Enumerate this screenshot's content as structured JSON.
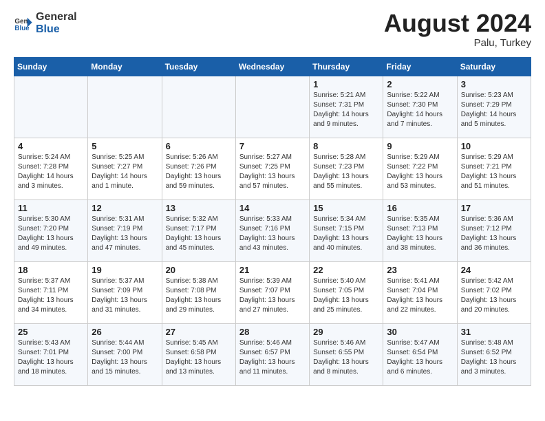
{
  "header": {
    "logo_general": "General",
    "logo_blue": "Blue",
    "month_year": "August 2024",
    "location": "Palu, Turkey"
  },
  "weekdays": [
    "Sunday",
    "Monday",
    "Tuesday",
    "Wednesday",
    "Thursday",
    "Friday",
    "Saturday"
  ],
  "weeks": [
    [
      {
        "day": "",
        "content": ""
      },
      {
        "day": "",
        "content": ""
      },
      {
        "day": "",
        "content": ""
      },
      {
        "day": "",
        "content": ""
      },
      {
        "day": "1",
        "content": "Sunrise: 5:21 AM\nSunset: 7:31 PM\nDaylight: 14 hours\nand 9 minutes."
      },
      {
        "day": "2",
        "content": "Sunrise: 5:22 AM\nSunset: 7:30 PM\nDaylight: 14 hours\nand 7 minutes."
      },
      {
        "day": "3",
        "content": "Sunrise: 5:23 AM\nSunset: 7:29 PM\nDaylight: 14 hours\nand 5 minutes."
      }
    ],
    [
      {
        "day": "4",
        "content": "Sunrise: 5:24 AM\nSunset: 7:28 PM\nDaylight: 14 hours\nand 3 minutes."
      },
      {
        "day": "5",
        "content": "Sunrise: 5:25 AM\nSunset: 7:27 PM\nDaylight: 14 hours\nand 1 minute."
      },
      {
        "day": "6",
        "content": "Sunrise: 5:26 AM\nSunset: 7:26 PM\nDaylight: 13 hours\nand 59 minutes."
      },
      {
        "day": "7",
        "content": "Sunrise: 5:27 AM\nSunset: 7:25 PM\nDaylight: 13 hours\nand 57 minutes."
      },
      {
        "day": "8",
        "content": "Sunrise: 5:28 AM\nSunset: 7:23 PM\nDaylight: 13 hours\nand 55 minutes."
      },
      {
        "day": "9",
        "content": "Sunrise: 5:29 AM\nSunset: 7:22 PM\nDaylight: 13 hours\nand 53 minutes."
      },
      {
        "day": "10",
        "content": "Sunrise: 5:29 AM\nSunset: 7:21 PM\nDaylight: 13 hours\nand 51 minutes."
      }
    ],
    [
      {
        "day": "11",
        "content": "Sunrise: 5:30 AM\nSunset: 7:20 PM\nDaylight: 13 hours\nand 49 minutes."
      },
      {
        "day": "12",
        "content": "Sunrise: 5:31 AM\nSunset: 7:19 PM\nDaylight: 13 hours\nand 47 minutes."
      },
      {
        "day": "13",
        "content": "Sunrise: 5:32 AM\nSunset: 7:17 PM\nDaylight: 13 hours\nand 45 minutes."
      },
      {
        "day": "14",
        "content": "Sunrise: 5:33 AM\nSunset: 7:16 PM\nDaylight: 13 hours\nand 43 minutes."
      },
      {
        "day": "15",
        "content": "Sunrise: 5:34 AM\nSunset: 7:15 PM\nDaylight: 13 hours\nand 40 minutes."
      },
      {
        "day": "16",
        "content": "Sunrise: 5:35 AM\nSunset: 7:13 PM\nDaylight: 13 hours\nand 38 minutes."
      },
      {
        "day": "17",
        "content": "Sunrise: 5:36 AM\nSunset: 7:12 PM\nDaylight: 13 hours\nand 36 minutes."
      }
    ],
    [
      {
        "day": "18",
        "content": "Sunrise: 5:37 AM\nSunset: 7:11 PM\nDaylight: 13 hours\nand 34 minutes."
      },
      {
        "day": "19",
        "content": "Sunrise: 5:37 AM\nSunset: 7:09 PM\nDaylight: 13 hours\nand 31 minutes."
      },
      {
        "day": "20",
        "content": "Sunrise: 5:38 AM\nSunset: 7:08 PM\nDaylight: 13 hours\nand 29 minutes."
      },
      {
        "day": "21",
        "content": "Sunrise: 5:39 AM\nSunset: 7:07 PM\nDaylight: 13 hours\nand 27 minutes."
      },
      {
        "day": "22",
        "content": "Sunrise: 5:40 AM\nSunset: 7:05 PM\nDaylight: 13 hours\nand 25 minutes."
      },
      {
        "day": "23",
        "content": "Sunrise: 5:41 AM\nSunset: 7:04 PM\nDaylight: 13 hours\nand 22 minutes."
      },
      {
        "day": "24",
        "content": "Sunrise: 5:42 AM\nSunset: 7:02 PM\nDaylight: 13 hours\nand 20 minutes."
      }
    ],
    [
      {
        "day": "25",
        "content": "Sunrise: 5:43 AM\nSunset: 7:01 PM\nDaylight: 13 hours\nand 18 minutes."
      },
      {
        "day": "26",
        "content": "Sunrise: 5:44 AM\nSunset: 7:00 PM\nDaylight: 13 hours\nand 15 minutes."
      },
      {
        "day": "27",
        "content": "Sunrise: 5:45 AM\nSunset: 6:58 PM\nDaylight: 13 hours\nand 13 minutes."
      },
      {
        "day": "28",
        "content": "Sunrise: 5:46 AM\nSunset: 6:57 PM\nDaylight: 13 hours\nand 11 minutes."
      },
      {
        "day": "29",
        "content": "Sunrise: 5:46 AM\nSunset: 6:55 PM\nDaylight: 13 hours\nand 8 minutes."
      },
      {
        "day": "30",
        "content": "Sunrise: 5:47 AM\nSunset: 6:54 PM\nDaylight: 13 hours\nand 6 minutes."
      },
      {
        "day": "31",
        "content": "Sunrise: 5:48 AM\nSunset: 6:52 PM\nDaylight: 13 hours\nand 3 minutes."
      }
    ]
  ]
}
